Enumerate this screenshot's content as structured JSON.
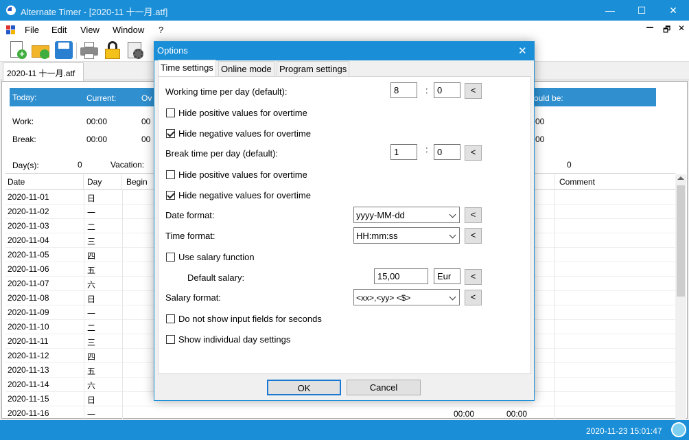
{
  "window": {
    "title": "Alternate Timer - [2020-11 十一月.atf]",
    "minimize": "—",
    "maximize": "☐",
    "close": "✕"
  },
  "menu": {
    "items": [
      "File",
      "Edit",
      "View",
      "Window",
      "?"
    ],
    "mdi_restore": "🗗",
    "mdi_close": "✕"
  },
  "toolbar": {
    "icons": [
      "new-file-icon",
      "open-folder-icon",
      "save-icon",
      "print-icon",
      "lock-icon",
      "settings-icon"
    ]
  },
  "doc_tab": {
    "label": "2020-11 十一月.atf"
  },
  "summary": {
    "today": "Today:",
    "current": "Current:",
    "ov": "Ov",
    "should_be": "ould be:",
    "work": "Work:",
    "work_current": "00:00",
    "work_ov": "00",
    "work_right": "00",
    "break": "Break:",
    "break_current": "00:00",
    "break_ov": "00",
    "break_right": "00",
    "days": "Day(s):",
    "days_val": "0",
    "vacation": "Vacation:",
    "right_val": "0"
  },
  "grid": {
    "columns": {
      "date": "Date",
      "day": "Day",
      "begin": "Begin",
      "comment": "Comment"
    },
    "rows": [
      {
        "date": "2020-11-01",
        "day": "日"
      },
      {
        "date": "2020-11-02",
        "day": "一"
      },
      {
        "date": "2020-11-03",
        "day": "二"
      },
      {
        "date": "2020-11-04",
        "day": "三"
      },
      {
        "date": "2020-11-05",
        "day": "四"
      },
      {
        "date": "2020-11-06",
        "day": "五"
      },
      {
        "date": "2020-11-07",
        "day": "六"
      },
      {
        "date": "2020-11-08",
        "day": "日"
      },
      {
        "date": "2020-11-09",
        "day": "一"
      },
      {
        "date": "2020-11-10",
        "day": "二"
      },
      {
        "date": "2020-11-11",
        "day": "三"
      },
      {
        "date": "2020-11-12",
        "day": "四"
      },
      {
        "date": "2020-11-13",
        "day": "五"
      },
      {
        "date": "2020-11-14",
        "day": "六"
      },
      {
        "date": "2020-11-15",
        "day": "日"
      },
      {
        "date": "2020-11-16",
        "day": "一"
      }
    ],
    "last_row_values": [
      "00:00",
      "00:00"
    ]
  },
  "status": {
    "datetime": "2020-11-23 15:01:47"
  },
  "dialog": {
    "title": "Options",
    "close": "✕",
    "tabs": [
      "Time settings",
      "Online mode",
      "Program settings"
    ],
    "working_time_label": "Working time per day (default):",
    "working_hours": "8",
    "working_minutes": "0",
    "colon": ":",
    "reset": "<",
    "hide_positive_1": "Hide positive values for overtime",
    "hide_negative_1": "Hide negative values for overtime",
    "break_time_label": "Break time per day (default):",
    "break_hours": "1",
    "break_minutes": "0",
    "hide_positive_2": "Hide positive values for overtime",
    "hide_negative_2": "Hide negative values for overtime",
    "date_format_label": "Date format:",
    "date_format": "yyyy-MM-dd",
    "time_format_label": "Time format:",
    "time_format": "HH:mm:ss",
    "salary_function_label": "Use salary function",
    "default_salary_label": "Default salary:",
    "default_salary": "15,00",
    "currency": "Eur",
    "salary_format_label": "Salary format:",
    "salary_format": "<xx>,<yy> <$>",
    "no_seconds_label": "Do not show input fields for seconds",
    "individual_day_label": "Show individual day settings",
    "ok": "OK",
    "cancel": "Cancel"
  }
}
